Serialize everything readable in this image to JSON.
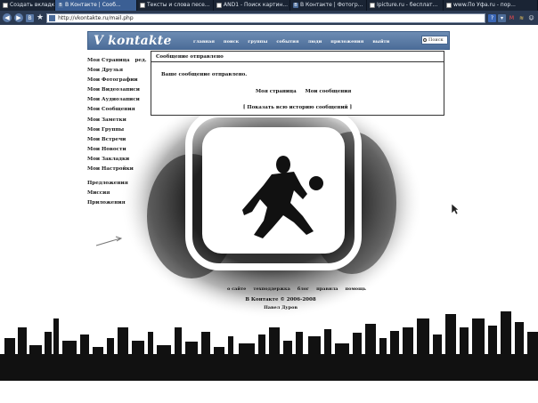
{
  "browser": {
    "tabs": [
      {
        "title": "Создать вкладку",
        "active": false
      },
      {
        "title": "В Контакте | Сооб...",
        "active": true
      },
      {
        "title": "Тексты и слова песе...",
        "active": false
      },
      {
        "title": "AND1 - Поиск картин...",
        "active": false
      },
      {
        "title": "В Контакте | Фотогр...",
        "active": false
      },
      {
        "title": "Ipicture.ru - бесплат...",
        "active": false
      },
      {
        "title": "www.По Уфа.ru - пор...",
        "active": false
      }
    ],
    "address": "http://vkontakte.ru/mail.php"
  },
  "site": {
    "logo": "V kontakte",
    "nav": [
      "главная",
      "поиск",
      "группы",
      "события",
      "люди",
      "приложения",
      "выйти"
    ],
    "search_placeholder": "Поиск"
  },
  "left_menu": {
    "items": [
      {
        "label": "Моя Страница",
        "extra": "ред."
      },
      {
        "label": "Мои Друзья"
      },
      {
        "label": "Мои Фотографии"
      },
      {
        "label": "Мои Видеозаписи"
      },
      {
        "label": "Мои Аудиозаписи"
      },
      {
        "label": "Мои Сообщения"
      },
      {
        "label": "Мои Заметки"
      },
      {
        "label": "Мои Группы"
      },
      {
        "label": "Мои Встречи"
      },
      {
        "label": "Мои Новости"
      },
      {
        "label": "Мои Закладки"
      },
      {
        "label": "Мои Настройки"
      }
    ],
    "extra_items": [
      "Предложения",
      "Миссия",
      "Приложения"
    ]
  },
  "message": {
    "title": "Сообщение отправлено",
    "text": "Ваше сообщение отправлено.",
    "links": [
      "Моя страница",
      "Мои сообщения"
    ],
    "history": "[ Показать всю историю сообщений ]"
  },
  "footer": {
    "links": [
      "о сайте",
      "техподдержка",
      "блог",
      "правила",
      "помощь"
    ],
    "copyright": "В Контакте © 2006-2008",
    "author": "Павел Дуров"
  },
  "colors": {
    "header_blue": "#4c6d99",
    "tab_bar": "#1a2434",
    "toolbar": "#2b3a52"
  }
}
